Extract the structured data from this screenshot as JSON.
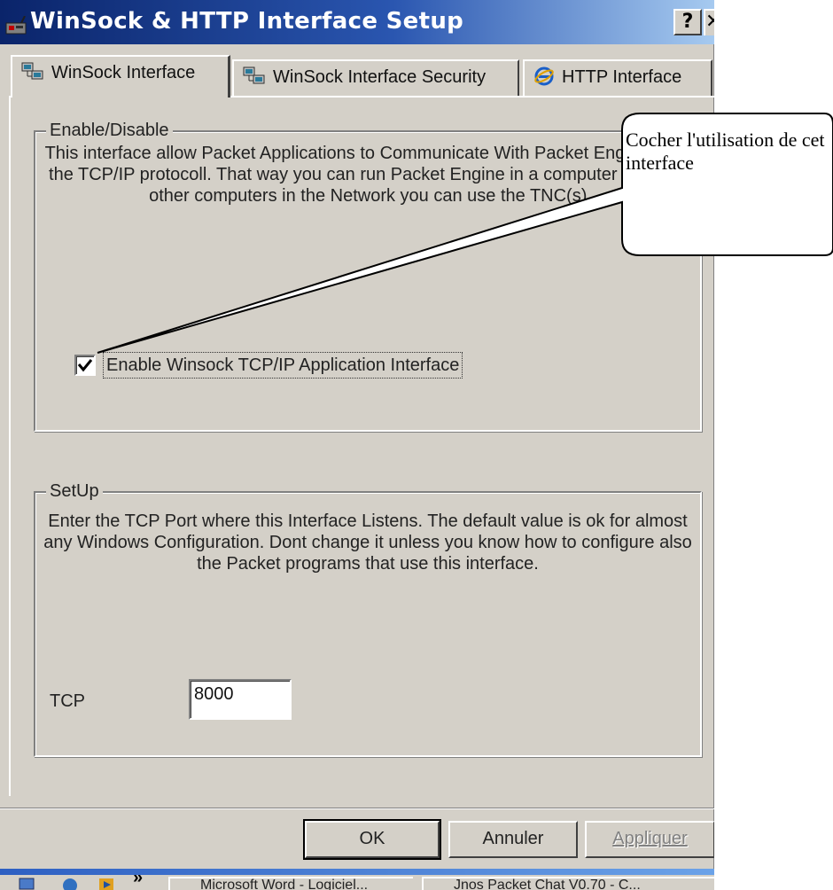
{
  "window": {
    "title": "WinSock & HTTP Interface Setup",
    "help_label": "?",
    "close_label": "✕"
  },
  "tabs": [
    {
      "label": "WinSock Interface",
      "icon": "network-computers-icon",
      "active": true
    },
    {
      "label": "WinSock Interface Security",
      "icon": "network-computers-icon",
      "active": false
    },
    {
      "label": "HTTP Interface",
      "icon": "internet-explorer-icon",
      "active": false
    }
  ],
  "enable_group": {
    "legend": "Enable/Disable",
    "description": "This interface allow Packet Applications to Communicate With Packet Engine using the TCP/IP protocoll. That way you can run Packet Engine in a computer and from other computers in the Network you can use the TNC(s).",
    "checkbox_label": "Enable Winsock TCP/IP Application Interface",
    "checkbox_checked": true
  },
  "setup_group": {
    "legend": "SetUp",
    "description": "Enter the TCP Port where this Interface Listens. The default value is ok for almost any Windows Configuration. Dont change it unless you know how to configure also the Packet programs that use this interface.",
    "tcp_label": "TCP",
    "tcp_value": "8000"
  },
  "buttons": {
    "ok": "OK",
    "cancel": "Annuler",
    "apply": "Appliquer",
    "apply_enabled": false
  },
  "callout": {
    "text": "Cocher l'utilisation de cet interface"
  },
  "taskbar": {
    "items": [
      {
        "label": "Microsoft Word - Logiciel..."
      },
      {
        "label": "Jnos Packet Chat V0.70 - C..."
      }
    ]
  },
  "colors": {
    "title_gradient_start": "#0a246a",
    "title_gradient_end": "#a6caf0",
    "face": "#d4d0c8"
  }
}
